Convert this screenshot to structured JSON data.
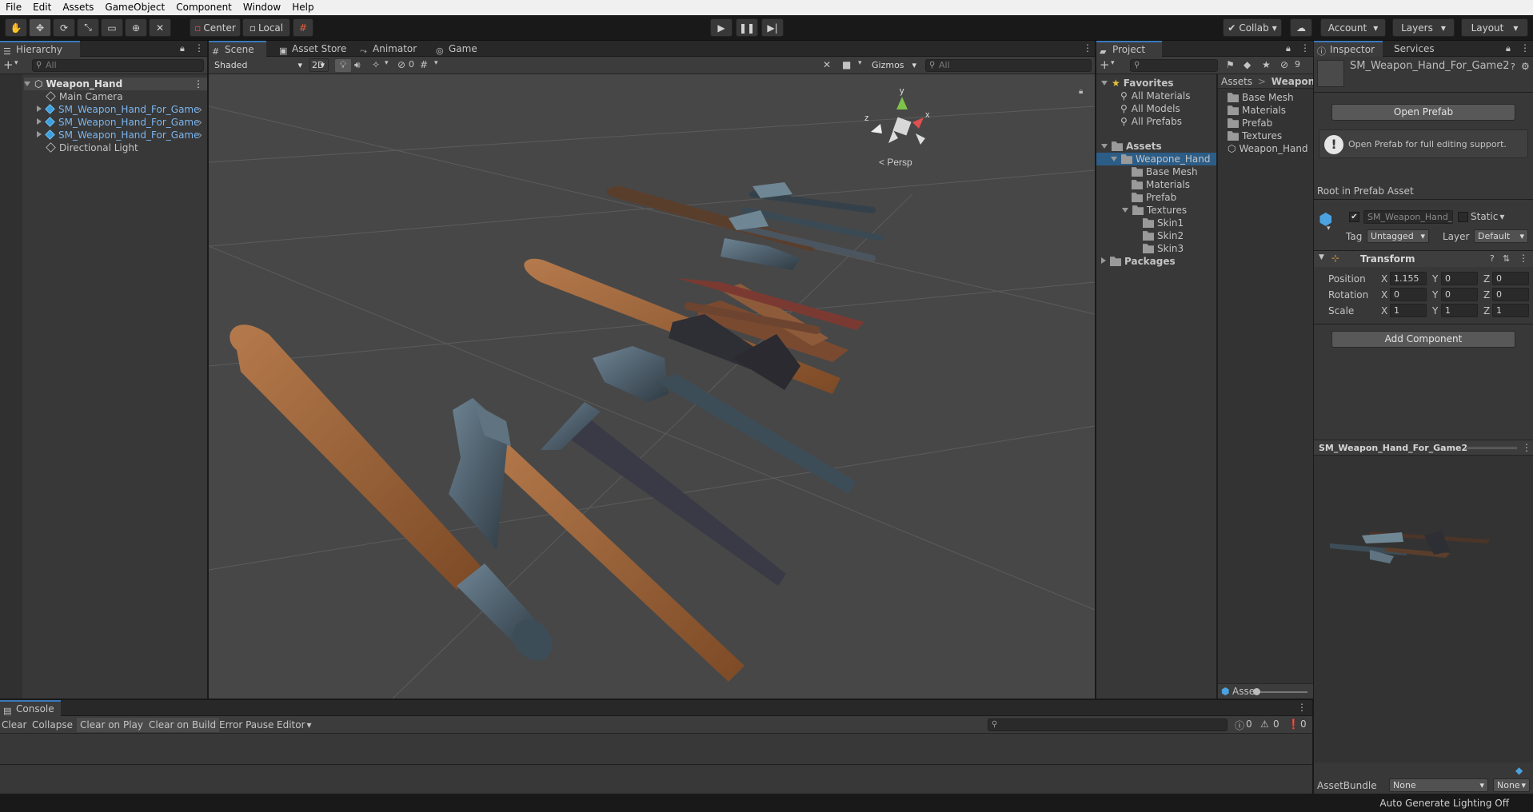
{
  "menu": [
    "File",
    "Edit",
    "Assets",
    "GameObject",
    "Component",
    "Window",
    "Help"
  ],
  "toolbar": {
    "pivot_label": "Center",
    "space_label": "Local",
    "collab_label": "Collab",
    "account_label": "Account",
    "layers_label": "Layers",
    "layout_label": "Layout"
  },
  "hierarchy": {
    "tab_label": "Hierarchy",
    "search_placeholder": "All",
    "root": "Weapon_Hand",
    "items": [
      {
        "label": "Main Camera",
        "type": "object"
      },
      {
        "label": "SM_Weapon_Hand_For_Game",
        "type": "prefab"
      },
      {
        "label": "SM_Weapon_Hand_For_Game",
        "type": "prefab"
      },
      {
        "label": "SM_Weapon_Hand_For_Game",
        "type": "prefab"
      },
      {
        "label": "Directional Light",
        "type": "object"
      }
    ]
  },
  "scene": {
    "tabs": [
      "Scene",
      "Asset Store",
      "Animator",
      "Game"
    ],
    "shading_mode": "Shaded",
    "toggle_2d": "2D",
    "hidden_count": "0",
    "gizmos_label": "Gizmos",
    "search_placeholder": "All",
    "persp_label": "Persp",
    "axis_x": "x",
    "axis_y": "y",
    "axis_z": "z"
  },
  "project": {
    "tab_label": "Project",
    "search_placeholder": "",
    "visible_count": "9",
    "favorites_label": "Favorites",
    "favorites": [
      "All Materials",
      "All Models",
      "All Prefabs"
    ],
    "assets_label": "Assets",
    "tree": [
      {
        "label": "Weapone_Hand",
        "depth": 1
      },
      {
        "label": "Base Mesh",
        "depth": 2
      },
      {
        "label": "Materials",
        "depth": 2
      },
      {
        "label": "Prefab",
        "depth": 2
      },
      {
        "label": "Textures",
        "depth": 2
      },
      {
        "label": "Skin1",
        "depth": 3
      },
      {
        "label": "Skin2",
        "depth": 3
      },
      {
        "label": "Skin3",
        "depth": 3
      }
    ],
    "packages_label": "Packages",
    "breadcrumb_root": "Assets",
    "breadcrumb_sep": ">",
    "breadcrumb_current": "Weapone_",
    "contents": [
      "Base Mesh",
      "Materials",
      "Prefab",
      "Textures",
      "Weapon_Hand"
    ],
    "footer_label": "Asse"
  },
  "inspector": {
    "tabs": [
      "Inspector",
      "Services"
    ],
    "object_name": "SM_Weapon_Hand_For_Game2",
    "open_prefab_label": "Open Prefab",
    "info_text": "Open Prefab for full editing support.",
    "root_label": "Root in Prefab Asset",
    "name_field": "SM_Weapon_Hand_For",
    "static_label": "Static",
    "tag_label": "Tag",
    "tag_value": "Untagged",
    "layer_label": "Layer",
    "layer_value": "Default",
    "transform_label": "Transform",
    "position_label": "Position",
    "rotation_label": "Rotation",
    "scale_label": "Scale",
    "axis_x": "X",
    "axis_y": "Y",
    "axis_z": "Z",
    "position": [
      "1.155",
      "0",
      "0"
    ],
    "rotation": [
      "0",
      "0",
      "0"
    ],
    "scale": [
      "1",
      "1",
      "1"
    ],
    "add_component_label": "Add Component",
    "preview_title": "SM_Weapon_Hand_For_Game2",
    "assetbundle_label": "AssetBundle",
    "assetbundle_value": "None",
    "assetbundle_variant": "None"
  },
  "console": {
    "tab_label": "Console",
    "buttons": [
      "Clear",
      "Collapse",
      "Clear on Play",
      "Clear on Build",
      "Error Pause",
      "Editor"
    ],
    "log_count": "0",
    "warn_count": "0",
    "error_count": "0"
  },
  "status": {
    "text": "Auto Generate Lighting Off"
  },
  "colors": {
    "accent": "#3a79bb",
    "panel": "#383838",
    "prefab_text": "#7bb6ef"
  }
}
